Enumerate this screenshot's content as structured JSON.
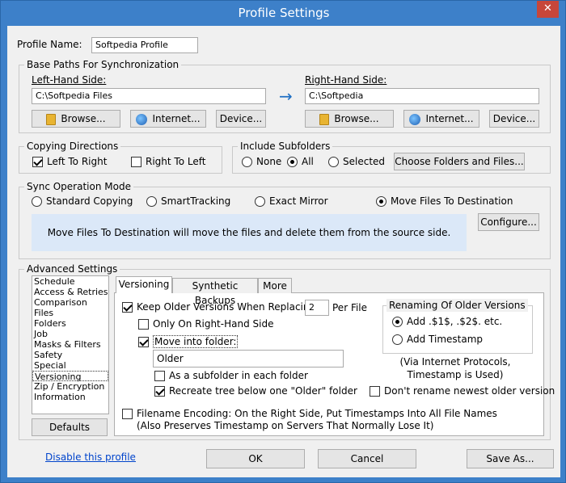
{
  "window": {
    "title": "Profile Settings",
    "close_glyph": "✕"
  },
  "profile": {
    "name_label": "Profile Name:",
    "name_value": "Softpedia Profile"
  },
  "base_paths": {
    "title": "Base Paths For Synchronization",
    "left_label": "Left-Hand Side:",
    "left_path": "C:\\Softpedia Files",
    "right_label": "Right-Hand Side:",
    "right_path": "C:\\Softpedia",
    "arrow": "→",
    "browse": "Browse...",
    "internet": "Internet...",
    "device": "Device..."
  },
  "copying": {
    "title": "Copying Directions",
    "ltr": "Left To Right",
    "rtl": "Right To Left",
    "ltr_checked": true,
    "rtl_checked": false
  },
  "subfolders": {
    "title": "Include Subfolders",
    "none": "None",
    "all": "All",
    "selected": "Selected",
    "choose": "Choose Folders and Files...",
    "value": "All"
  },
  "sync_mode": {
    "title": "Sync Operation Mode",
    "options": [
      "Standard Copying",
      "SmartTracking",
      "Exact Mirror",
      "Move Files To Destination"
    ],
    "selected": "Move Files To Destination",
    "configure": "Configure...",
    "description": "Move Files To Destination will move the files and delete them from the source side."
  },
  "advanced": {
    "title": "Advanced Settings",
    "items": [
      "Schedule",
      "Access & Retries",
      "Comparison",
      "Files",
      "Folders",
      "Job",
      "Masks & Filters",
      "Safety",
      "Special",
      "Versioning",
      "Zip / Encryption",
      "Information"
    ],
    "selected": "Versioning",
    "defaults": "Defaults",
    "tabs": [
      "Versioning",
      "Synthetic Backups",
      "More"
    ]
  },
  "versioning": {
    "keep_label": "Keep Older Versions When Replacing:",
    "keep_count": "2",
    "per_file": "Per File",
    "only_right": "Only On Right-Hand Side",
    "move_into": "Move into folder:",
    "folder_value": "Older",
    "as_subfolder": "As a subfolder in each folder",
    "recreate_tree": "Recreate tree below one \"Older\" folder",
    "renaming_title": "Renaming Of Older Versions",
    "add_s1": "Add .$1$, .$2$. etc.",
    "add_timestamp": "Add Timestamp",
    "note": "(Via Internet Protocols,\nTimestamp is Used)",
    "dont_rename": "Don't rename newest older version",
    "filename_encoding": "Filename Encoding: On the Right Side, Put Timestamps Into All File Names",
    "filename_encoding_2": "(Also Preserves Timestamp on Servers That Normally Lose It)"
  },
  "footer": {
    "disable_link": "Disable this profile",
    "ok": "OK",
    "cancel": "Cancel",
    "save_as": "Save As..."
  }
}
